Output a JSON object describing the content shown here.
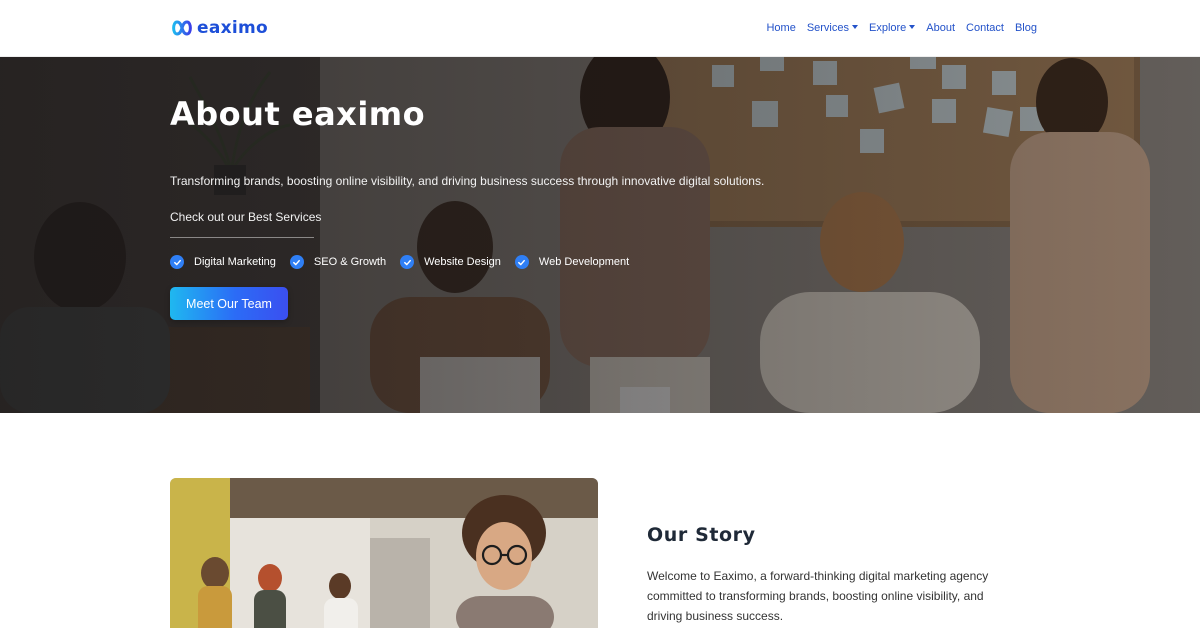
{
  "brand": {
    "name": "eaximo",
    "accent": "#1d4fd8"
  },
  "nav": {
    "links": [
      {
        "label": "Home",
        "dropdown": false
      },
      {
        "label": "Services",
        "dropdown": true
      },
      {
        "label": "Explore",
        "dropdown": true
      },
      {
        "label": "About",
        "dropdown": false
      },
      {
        "label": "Contact",
        "dropdown": false
      },
      {
        "label": "Blog",
        "dropdown": false
      }
    ]
  },
  "hero": {
    "title": "About eaximo",
    "subtitle": "Transforming brands, boosting online visibility, and driving business success through innovative digital solutions.",
    "kicker": "Check out our Best Services",
    "services": [
      "Digital Marketing",
      "SEO & Growth",
      "Website Design",
      "Web Development"
    ],
    "cta_label": "Meet Our Team",
    "icons": {
      "service": "check-circle-icon"
    },
    "colors": {
      "check": "#2f7ff5",
      "cta_start": "#1fb8f0",
      "cta_end": "#3b4ff0"
    }
  },
  "story": {
    "title": "Our Story",
    "body": "Welcome to Eaximo, a forward-thinking digital marketing agency committed to transforming brands, boosting online visibility, and driving business success."
  }
}
